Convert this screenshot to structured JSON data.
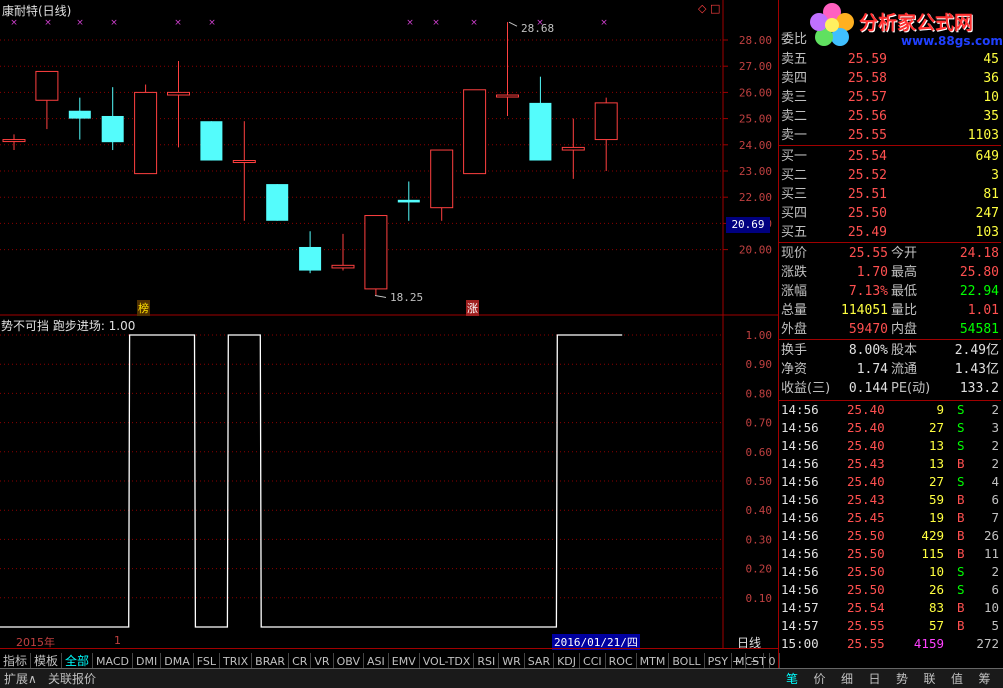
{
  "header": {
    "title": "康耐特(日线)",
    "markers": "◇ □"
  },
  "logo": {
    "text": "分析家公式网",
    "url": "www.88gs.com"
  },
  "price_axis": {
    "labels": [
      "28.00",
      "27.00",
      "26.00",
      "25.00",
      "24.00",
      "23.00",
      "22.00",
      "21.00",
      "20.00"
    ],
    "current": "20.69"
  },
  "candles": [
    {
      "o": 24.2,
      "c": 24.2,
      "h": 24.4,
      "l": 23.8
    },
    {
      "o": 25.7,
      "c": 26.8,
      "h": 26.8,
      "l": 24.6
    },
    {
      "o": 25.3,
      "c": 25.0,
      "h": 25.8,
      "l": 24.2
    },
    {
      "o": 25.1,
      "c": 24.1,
      "h": 26.2,
      "l": 23.8
    },
    {
      "o": 22.9,
      "c": 26.0,
      "h": 26.3,
      "l": 22.9
    },
    {
      "o": 25.9,
      "c": 26.0,
      "h": 27.2,
      "l": 23.9
    },
    {
      "o": 24.9,
      "c": 23.4,
      "h": 24.9,
      "l": 23.4
    },
    {
      "o": 23.4,
      "c": 23.4,
      "h": 24.9,
      "l": 21.1
    },
    {
      "o": 22.5,
      "c": 21.1,
      "h": 22.5,
      "l": 21.1
    },
    {
      "o": 20.1,
      "c": 19.2,
      "h": 20.7,
      "l": 19.1
    },
    {
      "o": 19.3,
      "c": 19.4,
      "h": 20.6,
      "l": 19.2
    },
    {
      "o": 18.5,
      "c": 21.3,
      "h": 21.3,
      "l": 18.25
    },
    {
      "o": 21.9,
      "c": 21.8,
      "h": 22.6,
      "l": 21.1
    },
    {
      "o": 21.6,
      "c": 23.8,
      "h": 23.8,
      "l": 21.1
    },
    {
      "o": 22.9,
      "c": 26.1,
      "h": 26.1,
      "l": 22.9
    },
    {
      "o": 25.9,
      "c": 25.9,
      "h": 28.68,
      "l": 25.1
    },
    {
      "o": 25.6,
      "c": 23.4,
      "h": 26.6,
      "l": 23.4
    },
    {
      "o": 23.8,
      "c": 23.9,
      "h": 25.0,
      "l": 22.7
    },
    {
      "o": 24.2,
      "c": 25.6,
      "h": 25.8,
      "l": 23.0
    }
  ],
  "annotations": {
    "high": "28.68",
    "low": "18.25",
    "mark1": "榜",
    "mark2": "涨"
  },
  "indicator": {
    "title": "势不可挡 跑步进场: 1.00",
    "axis_labels": [
      "1.00",
      "0.90",
      "0.80",
      "0.70",
      "0.60",
      "0.50",
      "0.40",
      "0.30",
      "0.20",
      "0.10"
    ],
    "values": [
      0,
      0,
      0,
      0,
      1,
      1,
      0,
      1,
      0,
      0,
      0,
      0,
      0,
      0,
      0,
      0,
      0,
      1,
      1
    ]
  },
  "timeline": {
    "year": "2015年",
    "idx": "1",
    "cursor_date": "2016/01/21/四",
    "period": "日线"
  },
  "tabs": [
    "指标",
    "模板",
    "全部",
    "MACD",
    "DMI",
    "DMA",
    "FSL",
    "TRIX",
    "BRAR",
    "CR",
    "VR",
    "OBV",
    "ASI",
    "EMV",
    "VOL-TDX",
    "RSI",
    "WR",
    "SAR",
    "KDJ",
    "CCI",
    "ROC",
    "MTM",
    "BOLL",
    "PSY",
    "MCST"
  ],
  "tab_controls": [
    "+",
    "−",
    "0"
  ],
  "order_book": {
    "weibi_label": "委比",
    "asks": [
      {
        "label": "卖五",
        "price": "25.59",
        "vol": "45"
      },
      {
        "label": "卖四",
        "price": "25.58",
        "vol": "36"
      },
      {
        "label": "卖三",
        "price": "25.57",
        "vol": "10"
      },
      {
        "label": "卖二",
        "price": "25.56",
        "vol": "35"
      },
      {
        "label": "卖一",
        "price": "25.55",
        "vol": "1103"
      }
    ],
    "bids": [
      {
        "label": "买一",
        "price": "25.54",
        "vol": "649"
      },
      {
        "label": "买二",
        "price": "25.52",
        "vol": "3"
      },
      {
        "label": "买三",
        "price": "25.51",
        "vol": "81"
      },
      {
        "label": "买四",
        "price": "25.50",
        "vol": "247"
      },
      {
        "label": "买五",
        "price": "25.49",
        "vol": "103"
      }
    ]
  },
  "stats": {
    "left": [
      {
        "label": "现价",
        "value": "25.55",
        "color": "#ff5050"
      },
      {
        "label": "涨跌",
        "value": "1.70",
        "color": "#ff5050"
      },
      {
        "label": "涨幅",
        "value": "7.13%",
        "color": "#ff5050"
      },
      {
        "label": "总量",
        "value": "114051",
        "color": "#ffff40"
      },
      {
        "label": "外盘",
        "value": "59470",
        "color": "#ff5050"
      }
    ],
    "right": [
      {
        "label": "今开",
        "value": "24.18",
        "color": "#ff5050"
      },
      {
        "label": "最高",
        "value": "25.80",
        "color": "#ff5050"
      },
      {
        "label": "最低",
        "value": "22.94",
        "color": "#00ff00"
      },
      {
        "label": "量比",
        "value": "1.01",
        "color": "#ff5050"
      },
      {
        "label": "内盘",
        "value": "54581",
        "color": "#00ff00"
      }
    ]
  },
  "fund": {
    "left": [
      {
        "label": "换手",
        "value": "8.00%"
      },
      {
        "label": "净资",
        "value": "1.74"
      },
      {
        "label": "收益(三)",
        "value": "0.144"
      }
    ],
    "right": [
      {
        "label": "股本",
        "value": "2.49亿"
      },
      {
        "label": "流通",
        "value": "1.43亿"
      },
      {
        "label": "PE(动)",
        "value": "133.2"
      }
    ]
  },
  "trades": [
    {
      "time": "14:56",
      "price": "25.40",
      "vol": "9",
      "side": "S",
      "n": "2"
    },
    {
      "time": "14:56",
      "price": "25.40",
      "vol": "27",
      "side": "S",
      "n": "3"
    },
    {
      "time": "14:56",
      "price": "25.40",
      "vol": "13",
      "side": "S",
      "n": "2"
    },
    {
      "time": "14:56",
      "price": "25.43",
      "vol": "13",
      "side": "B",
      "n": "2"
    },
    {
      "time": "14:56",
      "price": "25.40",
      "vol": "27",
      "side": "S",
      "n": "4"
    },
    {
      "time": "14:56",
      "price": "25.43",
      "vol": "59",
      "side": "B",
      "n": "6"
    },
    {
      "time": "14:56",
      "price": "25.45",
      "vol": "19",
      "side": "B",
      "n": "7"
    },
    {
      "time": "14:56",
      "price": "25.50",
      "vol": "429",
      "side": "B",
      "n": "26"
    },
    {
      "time": "14:56",
      "price": "25.50",
      "vol": "115",
      "side": "B",
      "n": "11"
    },
    {
      "time": "14:56",
      "price": "25.50",
      "vol": "10",
      "side": "S",
      "n": "2"
    },
    {
      "time": "14:56",
      "price": "25.50",
      "vol": "26",
      "side": "S",
      "n": "6"
    },
    {
      "time": "14:57",
      "price": "25.54",
      "vol": "83",
      "side": "B",
      "n": "10"
    },
    {
      "time": "14:57",
      "price": "25.55",
      "vol": "57",
      "side": "B",
      "n": "5"
    },
    {
      "time": "15:00",
      "price": "25.55",
      "vol": "4159",
      "side": "",
      "n": "272"
    }
  ],
  "status_left": [
    "扩展∧",
    "关联报价"
  ],
  "status_tabs": [
    "笔",
    "价",
    "细",
    "日",
    "势",
    "联",
    "值",
    "筹"
  ]
}
